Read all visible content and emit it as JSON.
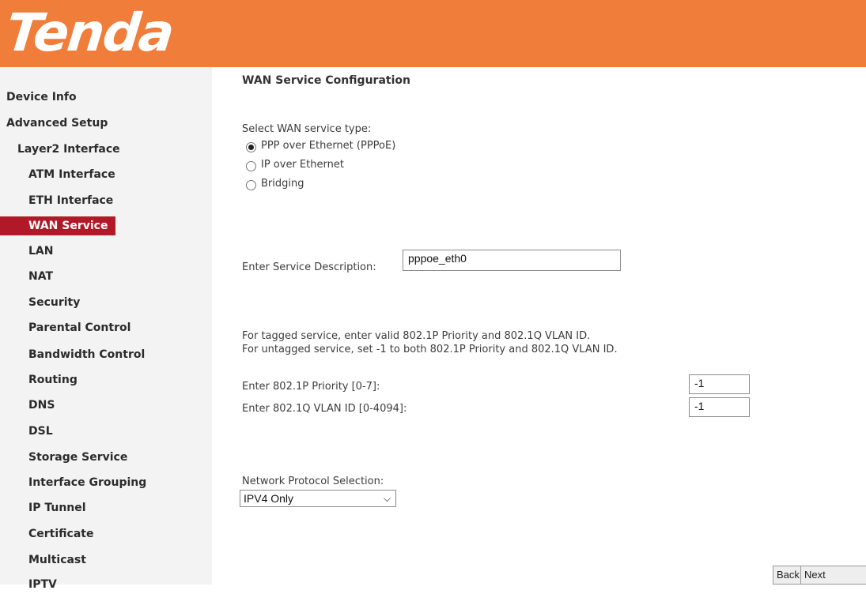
{
  "brand": {
    "logo": "Tenda",
    "header_color": "#f07d3a",
    "active_color": "#b01a28"
  },
  "sidebar": {
    "items": [
      {
        "label": "Device Info"
      },
      {
        "label": "Advanced Setup"
      },
      {
        "label": "Layer2 Interface"
      },
      {
        "label": "ATM Interface"
      },
      {
        "label": "ETH Interface"
      },
      {
        "label": "WAN Service",
        "active": true
      },
      {
        "label": "LAN"
      },
      {
        "label": "NAT"
      },
      {
        "label": "Security"
      },
      {
        "label": "Parental Control"
      },
      {
        "label": "Bandwidth Control"
      },
      {
        "label": "Routing"
      },
      {
        "label": "DNS"
      },
      {
        "label": "DSL"
      },
      {
        "label": "Storage Service"
      },
      {
        "label": "Interface Grouping"
      },
      {
        "label": "IP Tunnel"
      },
      {
        "label": "Certificate"
      },
      {
        "label": "Multicast"
      },
      {
        "label": "IPTV"
      }
    ]
  },
  "main": {
    "title": "WAN Service Configuration",
    "service_type_label": "Select WAN service type:",
    "service_types": [
      {
        "label": "PPP over Ethernet (PPPoE)",
        "checked": true
      },
      {
        "label": "IP over Ethernet",
        "checked": false
      },
      {
        "label": "Bridging",
        "checked": false
      }
    ],
    "description_label": "Enter Service Description:",
    "description_value": "pppoe_eth0",
    "tagged_note": "For tagged service, enter valid 802.1P Priority and 802.1Q VLAN ID.",
    "untagged_note": "For untagged service, set -1 to both 802.1P Priority and 802.1Q VLAN ID.",
    "priority_label": "Enter 802.1P Priority [0-7]:",
    "priority_value": "-1",
    "vlan_label": "Enter 802.1Q VLAN ID [0-4094]:",
    "vlan_value": "-1",
    "protocol_label": "Network Protocol Selection:",
    "protocol_value": "IPV4 Only"
  },
  "buttons": {
    "back": "Back",
    "next": "Next"
  }
}
